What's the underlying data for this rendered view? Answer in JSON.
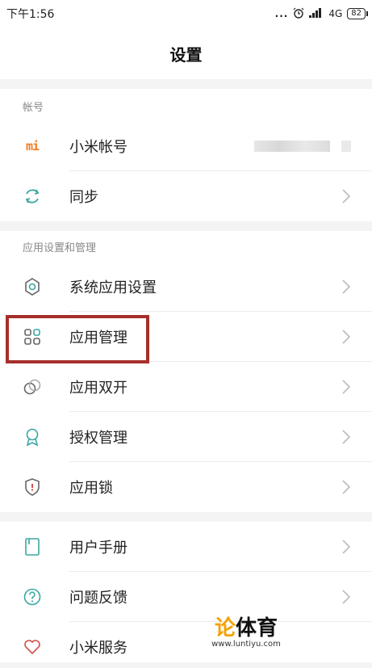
{
  "status_bar": {
    "time": "下午1:56",
    "dots": "...",
    "network": "4G",
    "battery": "82"
  },
  "header": {
    "title": "设置"
  },
  "sections": {
    "account": {
      "title": "帐号"
    },
    "apps": {
      "title": "应用设置和管理"
    }
  },
  "rows": {
    "mi_account": {
      "label": "小米帐号",
      "icon": "mi-logo-icon"
    },
    "sync": {
      "label": "同步",
      "icon": "sync-icon"
    },
    "system_apps": {
      "label": "系统应用设置",
      "icon": "gear-icon"
    },
    "app_management": {
      "label": "应用管理",
      "icon": "grid-icon"
    },
    "dual_apps": {
      "label": "应用双开",
      "icon": "dual-circles-icon"
    },
    "permissions": {
      "label": "授权管理",
      "icon": "badge-icon"
    },
    "app_lock": {
      "label": "应用锁",
      "icon": "shield-icon"
    },
    "user_guide": {
      "label": "用户手册",
      "icon": "book-icon"
    },
    "feedback": {
      "label": "问题反馈",
      "icon": "question-icon"
    },
    "mi_service": {
      "label": "小米服务",
      "icon": "heart-icon"
    }
  },
  "logo": {
    "mi_text": "mi"
  },
  "watermark": {
    "part1": "论",
    "part2": "体育",
    "url": "www.luntiyu.com"
  },
  "colors": {
    "accent_teal": "#3aa7a0",
    "mi_orange": "#f37b1d",
    "highlight_red": "#a52f2a",
    "shield_red": "#d0504a"
  }
}
